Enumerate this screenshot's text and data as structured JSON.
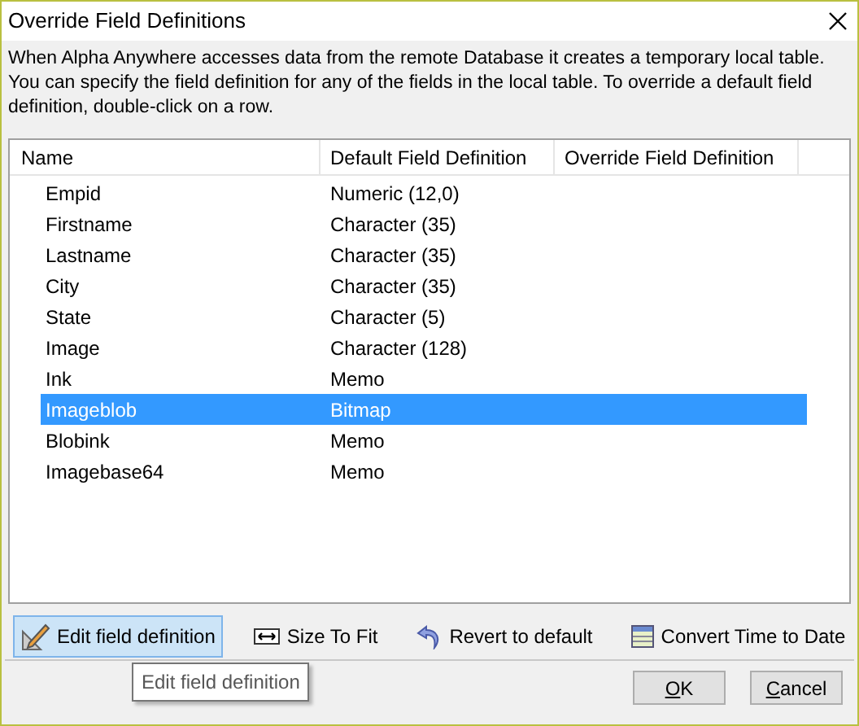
{
  "window": {
    "title": "Override Field Definitions"
  },
  "description": "When Alpha Anywhere accesses data from the remote Database it creates a temporary local table. You can specify the field definition for any of the fields in the local table. To override a default field definition, double-click on a row.",
  "table": {
    "columns": [
      "Name",
      "Default Field Definition",
      "Override Field Definition"
    ],
    "rows": [
      {
        "name": "Empid",
        "default": "Numeric (12,0)",
        "selected": false
      },
      {
        "name": "Firstname",
        "default": "Character (35)",
        "selected": false
      },
      {
        "name": "Lastname",
        "default": "Character (35)",
        "selected": false
      },
      {
        "name": "City",
        "default": "Character (35)",
        "selected": false
      },
      {
        "name": "State",
        "default": "Character (5)",
        "selected": false
      },
      {
        "name": "Image",
        "default": "Character (128)",
        "selected": false
      },
      {
        "name": "Ink",
        "default": "Memo",
        "selected": false
      },
      {
        "name": "Imageblob",
        "default": "Bitmap",
        "selected": true
      },
      {
        "name": "Blobink",
        "default": "Memo",
        "selected": false
      },
      {
        "name": "Imagebase64",
        "default": "Memo",
        "selected": false
      }
    ]
  },
  "toolbar": [
    {
      "kind": "edit",
      "label": "Edit field definition",
      "hovered": true
    },
    {
      "kind": "fit",
      "label": "Size To Fit",
      "hovered": false
    },
    {
      "kind": "revert",
      "label": "Revert to default",
      "hovered": false
    },
    {
      "kind": "convert",
      "label": "Convert Time to Date",
      "hovered": false
    }
  ],
  "tooltip": "Edit field definition",
  "buttons": [
    {
      "label": "OK",
      "mnemonic": true
    },
    {
      "label": "Cancel",
      "mnemonic": true
    }
  ]
}
